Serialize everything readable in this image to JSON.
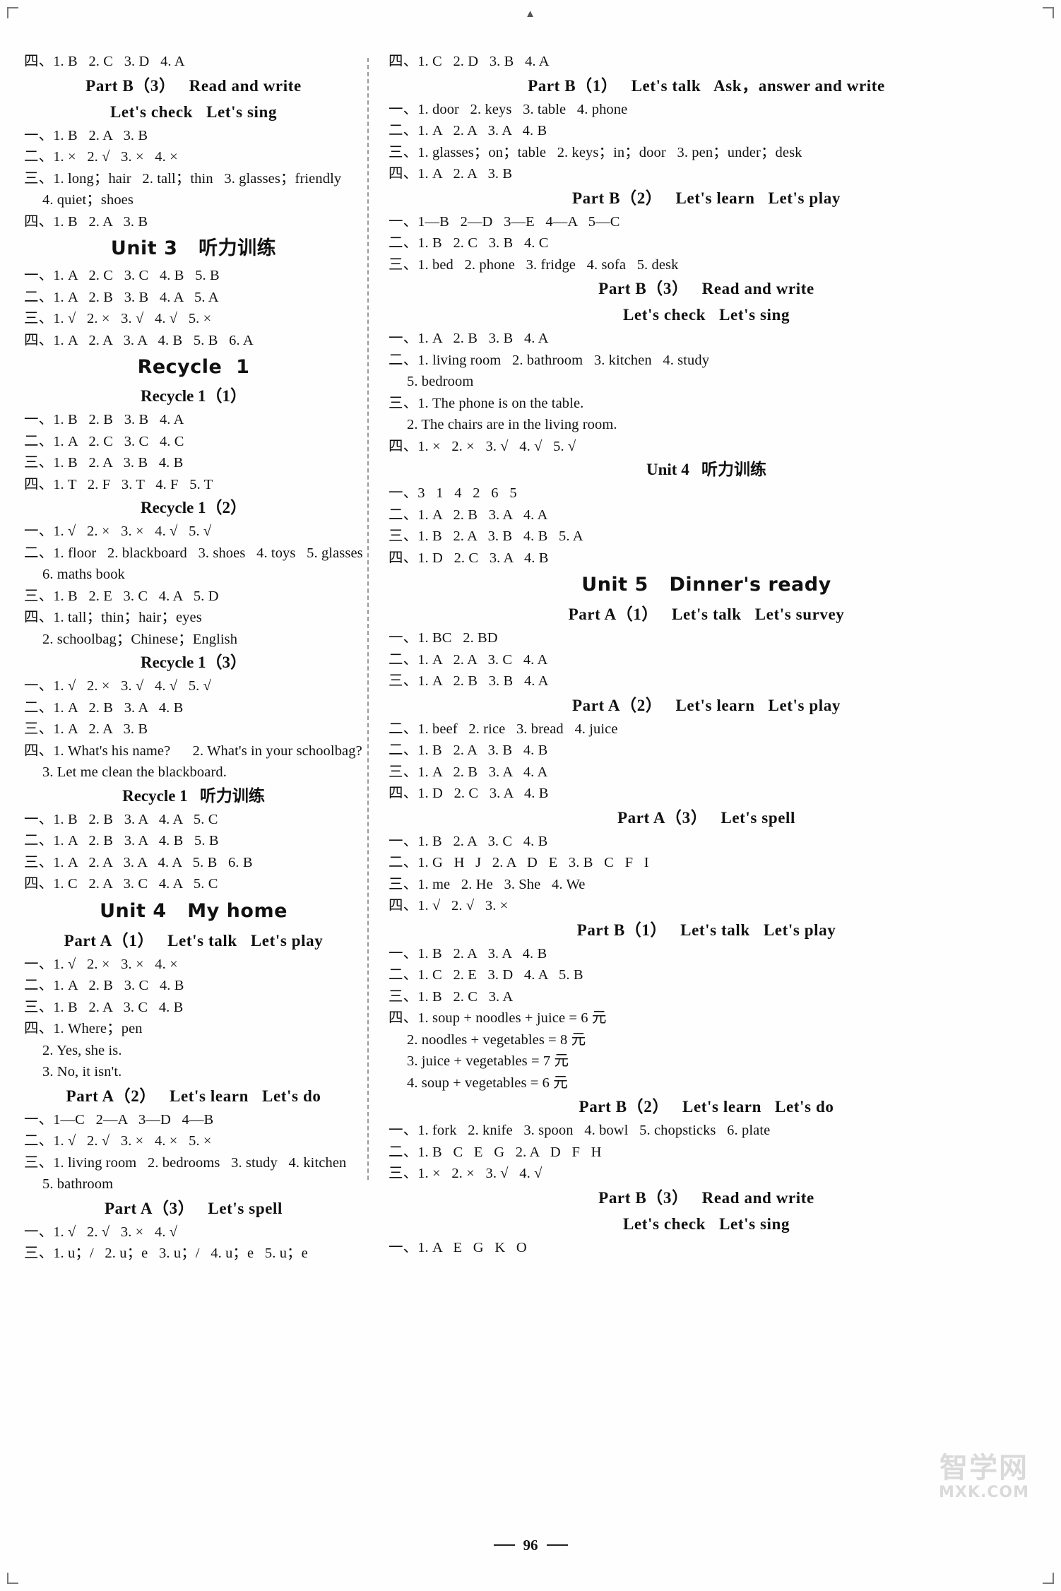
{
  "page": {
    "number": "96",
    "top_mark": "▲",
    "watermark_cn": "智学网",
    "watermark_en": "MXK.COM"
  },
  "left_column": [
    {
      "type": "answer",
      "text": "四、1. B   2. C   3. D   4. A"
    },
    {
      "type": "heading_part",
      "text": "Part B（3）   Read and write"
    },
    {
      "type": "heading_part",
      "text": "Let's check   Let's sing"
    },
    {
      "type": "answer",
      "text": "一、1. B   2. A   3. B"
    },
    {
      "type": "answer",
      "text": "二、1. ×   2. √   3. ×   4. ×"
    },
    {
      "type": "answer",
      "text": "三、1. long；hair   2. tall；thin   3. glasses；friendly"
    },
    {
      "type": "answer_indent",
      "text": "4. quiet；shoes"
    },
    {
      "type": "answer",
      "text": "四、1. B   2. A   3. B"
    },
    {
      "type": "heading_unit",
      "text": "Unit 3   听力训练"
    },
    {
      "type": "answer",
      "text": "一、1. A   2. C   3. C   4. B   5. B"
    },
    {
      "type": "answer",
      "text": "二、1. A   2. B   3. B   4. A   5. A"
    },
    {
      "type": "answer",
      "text": "三、1. √   2. ×   3. √   4. √   5. ×"
    },
    {
      "type": "answer",
      "text": "四、1. A   2. A   3. A   4. B   5. B   6. A"
    },
    {
      "type": "heading_unit",
      "text": "Recycle  1"
    },
    {
      "type": "heading_sub",
      "text": "Recycle 1（1）"
    },
    {
      "type": "answer",
      "text": "一、1. B   2. B   3. B   4. A"
    },
    {
      "type": "answer",
      "text": "二、1. A   2. C   3. C   4. C"
    },
    {
      "type": "answer",
      "text": "三、1. B   2. A   3. B   4. B"
    },
    {
      "type": "answer",
      "text": "四、1. T   2. F   3. T   4. F   5. T"
    },
    {
      "type": "heading_sub",
      "text": "Recycle 1（2）"
    },
    {
      "type": "answer",
      "text": "一、1. √   2. ×   3. ×   4. √   5. √"
    },
    {
      "type": "answer",
      "text": "二、1. floor   2. blackboard   3. shoes   4. toys   5. glasses"
    },
    {
      "type": "answer_indent",
      "text": "6. maths book"
    },
    {
      "type": "answer",
      "text": "三、1. B   2. E   3. C   4. A   5. D"
    },
    {
      "type": "answer",
      "text": "四、1. tall；thin；hair；eyes"
    },
    {
      "type": "answer_indent",
      "text": "2. schoolbag；Chinese；English"
    },
    {
      "type": "heading_sub",
      "text": "Recycle 1（3）"
    },
    {
      "type": "answer",
      "text": "一、1. √   2. ×   3. √   4. √   5. √"
    },
    {
      "type": "answer",
      "text": "二、1. A   2. B   3. A   4. B"
    },
    {
      "type": "answer",
      "text": "三、1. A   2. A   3. B"
    },
    {
      "type": "answer",
      "text": "四、1. What's his name?      2. What's in your schoolbag?"
    },
    {
      "type": "answer_indent",
      "text": "3. Let me clean the blackboard."
    },
    {
      "type": "heading_sub",
      "text": "Recycle 1   听力训练"
    },
    {
      "type": "answer",
      "text": "一、1. B   2. B   3. A   4. A   5. C"
    },
    {
      "type": "answer",
      "text": "二、1. A   2. B   3. A   4. B   5. B"
    },
    {
      "type": "answer",
      "text": "三、1. A   2. A   3. A   4. A   5. B   6. B"
    },
    {
      "type": "answer",
      "text": "四、1. C   2. A   3. C   4. A   5. C"
    },
    {
      "type": "heading_unit",
      "text": "Unit 4   My home"
    },
    {
      "type": "heading_part",
      "text": "Part A（1）   Let's talk   Let's play"
    },
    {
      "type": "answer",
      "text": "一、1. √   2. ×   3. ×   4. ×"
    },
    {
      "type": "answer",
      "text": "二、1. A   2. B   3. C   4. B"
    },
    {
      "type": "answer",
      "text": "三、1. B   2. A   3. C   4. B"
    },
    {
      "type": "answer",
      "text": "四、1. Where；pen"
    },
    {
      "type": "answer_indent",
      "text": "2. Yes, she is."
    },
    {
      "type": "answer_indent",
      "text": "3. No, it isn't."
    },
    {
      "type": "heading_part",
      "text": "Part A（2）   Let's learn   Let's do"
    },
    {
      "type": "answer",
      "text": "一、1—C   2—A   3—D   4—B"
    },
    {
      "type": "answer",
      "text": "二、1. √   2. √   3. ×   4. ×   5. ×"
    },
    {
      "type": "answer",
      "text": "三、1. living room   2. bedrooms   3. study   4. kitchen"
    },
    {
      "type": "answer_indent",
      "text": "5. bathroom"
    },
    {
      "type": "heading_part",
      "text": "Part A（3）   Let's spell"
    },
    {
      "type": "answer",
      "text": "一、1. √   2. √   3. ×   4. √"
    },
    {
      "type": "answer",
      "text": "三、1. u；/   2. u；e   3. u；/   4. u；e   5. u；e"
    }
  ],
  "right_column": [
    {
      "type": "answer",
      "text": "四、1. C   2. D   3. B   4. A"
    },
    {
      "type": "heading_part",
      "text": "Part B（1）   Let's talk   Ask，answer and write"
    },
    {
      "type": "answer",
      "text": "一、1. door   2. keys   3. table   4. phone"
    },
    {
      "type": "answer",
      "text": "二、1. A   2. A   3. A   4. B"
    },
    {
      "type": "answer",
      "text": "三、1. glasses；on；table   2. keys；in；door   3. pen；under；desk"
    },
    {
      "type": "answer",
      "text": "四、1. A   2. A   3. B"
    },
    {
      "type": "heading_part",
      "text": "Part B（2）   Let's learn   Let's play"
    },
    {
      "type": "answer",
      "text": "一、1—B   2—D   3—E   4—A   5—C"
    },
    {
      "type": "answer",
      "text": "二、1. B   2. C   3. B   4. C"
    },
    {
      "type": "answer",
      "text": "三、1. bed   2. phone   3. fridge   4. sofa   5. desk"
    },
    {
      "type": "heading_part",
      "text": "Part B（3）   Read and write"
    },
    {
      "type": "heading_part",
      "text": "Let's check   Let's sing"
    },
    {
      "type": "answer",
      "text": "一、1. A   2. B   3. B   4. A"
    },
    {
      "type": "answer",
      "text": "二、1. living room   2. bathroom   3. kitchen   4. study"
    },
    {
      "type": "answer_indent",
      "text": "5. bedroom"
    },
    {
      "type": "answer",
      "text": "三、1. The phone is on the table."
    },
    {
      "type": "answer_indent",
      "text": "2. The chairs are in the living room."
    },
    {
      "type": "answer",
      "text": "四、1. ×   2. ×   3. √   4. √   5. √"
    },
    {
      "type": "heading_sub",
      "text": "Unit 4   听力训练"
    },
    {
      "type": "answer",
      "text": "一、3   1   4   2   6   5"
    },
    {
      "type": "answer",
      "text": "二、1. A   2. B   3. A   4. A"
    },
    {
      "type": "answer",
      "text": "三、1. B   2. A   3. B   4. B   5. A"
    },
    {
      "type": "answer",
      "text": "四、1. D   2. C   3. A   4. B"
    },
    {
      "type": "heading_unit",
      "text": "Unit 5   Dinner's ready"
    },
    {
      "type": "heading_part",
      "text": "Part A（1）   Let's talk   Let's survey"
    },
    {
      "type": "answer",
      "text": "一、1. BC   2. BD"
    },
    {
      "type": "answer",
      "text": "二、1. A   2. A   3. C   4. A"
    },
    {
      "type": "answer",
      "text": "三、1. A   2. B   3. B   4. A"
    },
    {
      "type": "heading_part",
      "text": "Part A（2）   Let's learn   Let's play"
    },
    {
      "type": "answer",
      "text": "二、1. beef   2. rice   3. bread   4. juice"
    },
    {
      "type": "answer",
      "text": "二、1. B   2. A   3. B   4. B"
    },
    {
      "type": "answer",
      "text": "三、1. A   2. B   3. A   4. A"
    },
    {
      "type": "answer",
      "text": "四、1. D   2. C   3. A   4. B"
    },
    {
      "type": "heading_part",
      "text": "Part A（3）   Let's spell"
    },
    {
      "type": "answer",
      "text": "一、1. B   2. A   3. C   4. B"
    },
    {
      "type": "answer",
      "text": "二、1. G   H   J   2. A   D   E   3. B   C   F   I"
    },
    {
      "type": "answer",
      "text": "三、1. me   2. He   3. She   4. We"
    },
    {
      "type": "answer",
      "text": "四、1. √   2. √   3. ×"
    },
    {
      "type": "heading_part",
      "text": "Part B（1）   Let's talk   Let's play"
    },
    {
      "type": "answer",
      "text": "一、1. B   2. A   3. A   4. B"
    },
    {
      "type": "answer",
      "text": "二、1. C   2. E   3. D   4. A   5. B"
    },
    {
      "type": "answer",
      "text": "三、1. B   2. C   3. A"
    },
    {
      "type": "answer",
      "text": "四、1. soup + noodles + juice = 6 元"
    },
    {
      "type": "answer_indent",
      "text": "2. noodles + vegetables = 8 元"
    },
    {
      "type": "answer_indent",
      "text": "3. juice + vegetables = 7 元"
    },
    {
      "type": "answer_indent",
      "text": "4. soup + vegetables = 6 元"
    },
    {
      "type": "heading_part",
      "text": "Part B（2）   Let's learn   Let's do"
    },
    {
      "type": "answer",
      "text": "一、1. fork   2. knife   3. spoon   4. bowl   5. chopsticks   6. plate"
    },
    {
      "type": "answer",
      "text": "二、1. B   C   E   G   2. A   D   F   H"
    },
    {
      "type": "answer",
      "text": "三、1. ×   2. ×   3. √   4. √"
    },
    {
      "type": "heading_part",
      "text": "Part B（3）   Read and write"
    },
    {
      "type": "heading_part",
      "text": "Let's check   Let's sing"
    },
    {
      "type": "answer",
      "text": "一、1. A   E   G   K   O"
    }
  ]
}
